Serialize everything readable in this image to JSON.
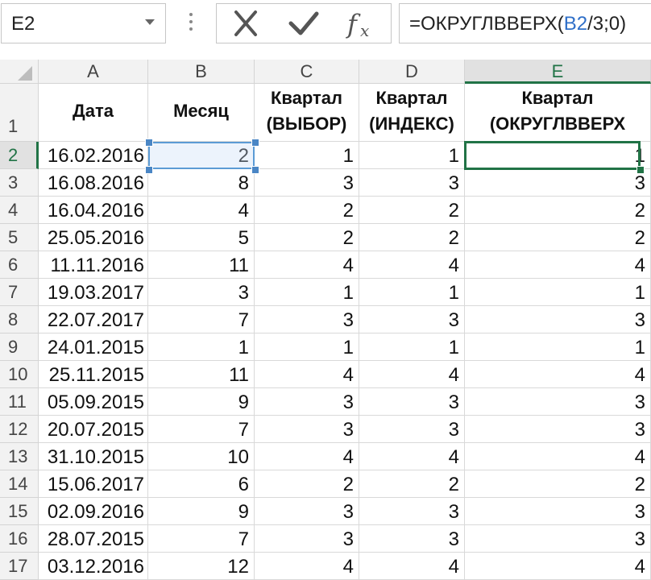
{
  "name_box": {
    "value": "E2"
  },
  "formula_bar": {
    "prefix": "=ОКРУГЛВВЕРХ(",
    "ref": "B2",
    "suffix": "/3;0)"
  },
  "colors": {
    "selection_green": "#217346",
    "reference_blue": "#5b9bd5"
  },
  "columns": [
    "A",
    "B",
    "C",
    "D",
    "E"
  ],
  "selected_column": "E",
  "header_row": {
    "row_number": "1",
    "a": "Дата",
    "b": "Месяц",
    "c_line1": "Квартал",
    "c_line2": "(ВЫБОР)",
    "d_line1": "Квартал",
    "d_line2": "(ИНДЕКС)",
    "e_line1": "Квартал",
    "e_line2": "(ОКРУГЛВВЕРХ"
  },
  "rows": [
    {
      "num": "2",
      "date": "16.02.2016",
      "month": "2",
      "choose": "1",
      "index": "1",
      "roundup": "1"
    },
    {
      "num": "3",
      "date": "16.08.2016",
      "month": "8",
      "choose": "3",
      "index": "3",
      "roundup": "3"
    },
    {
      "num": "4",
      "date": "16.04.2016",
      "month": "4",
      "choose": "2",
      "index": "2",
      "roundup": "2"
    },
    {
      "num": "5",
      "date": "25.05.2016",
      "month": "5",
      "choose": "2",
      "index": "2",
      "roundup": "2"
    },
    {
      "num": "6",
      "date": "11.11.2016",
      "month": "11",
      "choose": "4",
      "index": "4",
      "roundup": "4"
    },
    {
      "num": "7",
      "date": "19.03.2017",
      "month": "3",
      "choose": "1",
      "index": "1",
      "roundup": "1"
    },
    {
      "num": "8",
      "date": "22.07.2017",
      "month": "7",
      "choose": "3",
      "index": "3",
      "roundup": "3"
    },
    {
      "num": "9",
      "date": "24.01.2015",
      "month": "1",
      "choose": "1",
      "index": "1",
      "roundup": "1"
    },
    {
      "num": "10",
      "date": "25.11.2015",
      "month": "11",
      "choose": "4",
      "index": "4",
      "roundup": "4"
    },
    {
      "num": "11",
      "date": "05.09.2015",
      "month": "9",
      "choose": "3",
      "index": "3",
      "roundup": "3"
    },
    {
      "num": "12",
      "date": "20.07.2015",
      "month": "7",
      "choose": "3",
      "index": "3",
      "roundup": "3"
    },
    {
      "num": "13",
      "date": "31.10.2015",
      "month": "10",
      "choose": "4",
      "index": "4",
      "roundup": "4"
    },
    {
      "num": "14",
      "date": "15.06.2017",
      "month": "6",
      "choose": "2",
      "index": "2",
      "roundup": "2"
    },
    {
      "num": "15",
      "date": "02.09.2016",
      "month": "9",
      "choose": "3",
      "index": "3",
      "roundup": "3"
    },
    {
      "num": "16",
      "date": "28.07.2015",
      "month": "7",
      "choose": "3",
      "index": "3",
      "roundup": "3"
    },
    {
      "num": "17",
      "date": "03.12.2016",
      "month": "12",
      "choose": "4",
      "index": "4",
      "roundup": "4"
    }
  ]
}
